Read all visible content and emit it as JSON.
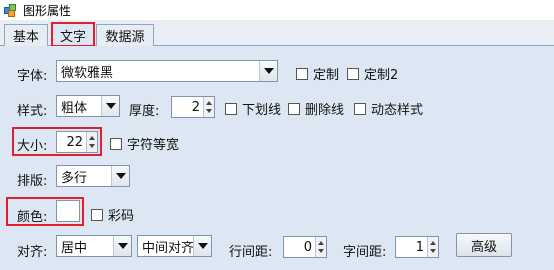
{
  "window": {
    "title": "图形属性",
    "icon": "app-shapes-icon"
  },
  "tabs": [
    {
      "label": "基本",
      "active": false
    },
    {
      "label": "文字",
      "active": true
    },
    {
      "label": "数据源",
      "active": false
    }
  ],
  "form": {
    "font": {
      "label": "字体:",
      "value": "微软雅黑",
      "custom1": "定制",
      "custom2": "定制2"
    },
    "style": {
      "label": "样式:",
      "value": "粗体",
      "thickness_label": "厚度:",
      "thickness_value": "2",
      "underline": "下划线",
      "strikethrough": "删除线",
      "dynamic": "动态样式"
    },
    "size": {
      "label": "大小:",
      "value": "22",
      "monospace": "字符等宽"
    },
    "layout": {
      "label": "排版:",
      "value": "多行"
    },
    "color": {
      "label": "颜色:",
      "value": "#ffffff",
      "colorcode": "彩码"
    },
    "align": {
      "label": "对齐:",
      "h_value": "居中",
      "v_value": "中间对齐",
      "line_spacing_label": "行间距:",
      "line_spacing_value": "0",
      "char_spacing_label": "字间距:",
      "char_spacing_value": "1",
      "advanced_button": "高级"
    }
  },
  "colors": {
    "highlight": "#e0202c",
    "panel": "#dde7f3"
  }
}
